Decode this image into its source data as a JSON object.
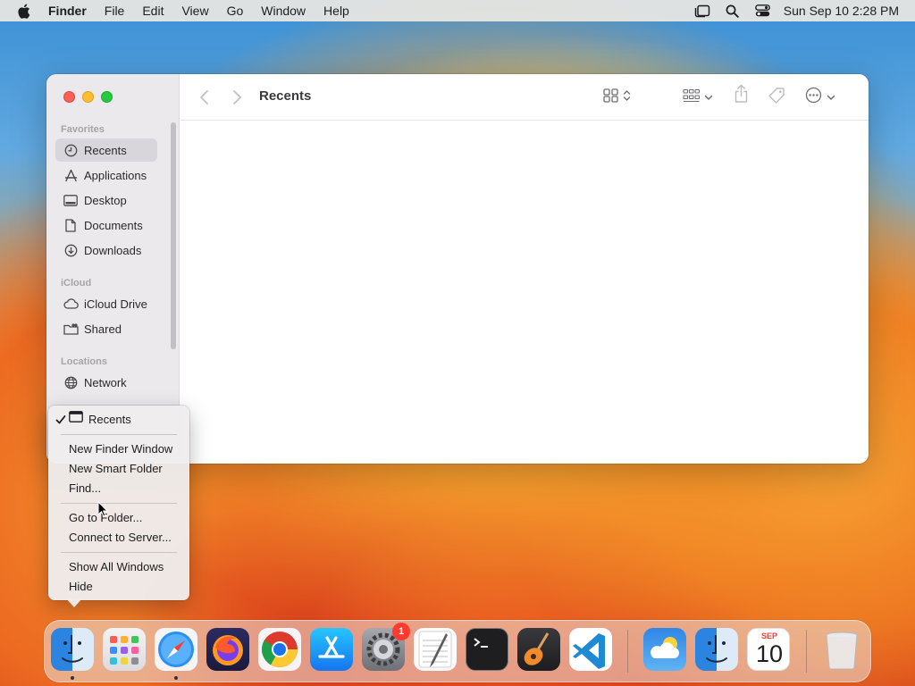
{
  "menubar": {
    "app_name": "Finder",
    "items": [
      "File",
      "Edit",
      "View",
      "Go",
      "Window",
      "Help"
    ],
    "clock": "Sun Sep 10  2:28 PM"
  },
  "window": {
    "title": "Recents",
    "sidebar": {
      "sections": {
        "favorites": "Favorites",
        "icloud": "iCloud",
        "locations": "Locations"
      },
      "items": {
        "recents": "Recents",
        "applications": "Applications",
        "desktop": "Desktop",
        "documents": "Documents",
        "downloads": "Downloads",
        "icloud_drive": "iCloud Drive",
        "shared": "Shared",
        "network": "Network"
      }
    }
  },
  "context_menu": {
    "current": "Recents",
    "items": {
      "new_window": "New Finder Window",
      "new_smart_folder": "New Smart Folder",
      "find": "Find...",
      "go_to_folder": "Go to Folder...",
      "connect_server": "Connect to Server...",
      "show_all_windows": "Show All Windows",
      "hide": "Hide"
    }
  },
  "dock": {
    "settings_badge": "1",
    "calendar_month": "SEP",
    "calendar_day": "10"
  },
  "colors": {
    "accent": "#007aff",
    "close": "#fe5f57",
    "minimize": "#febc2e",
    "maximize": "#28c840",
    "badge": "#ff3b30"
  }
}
